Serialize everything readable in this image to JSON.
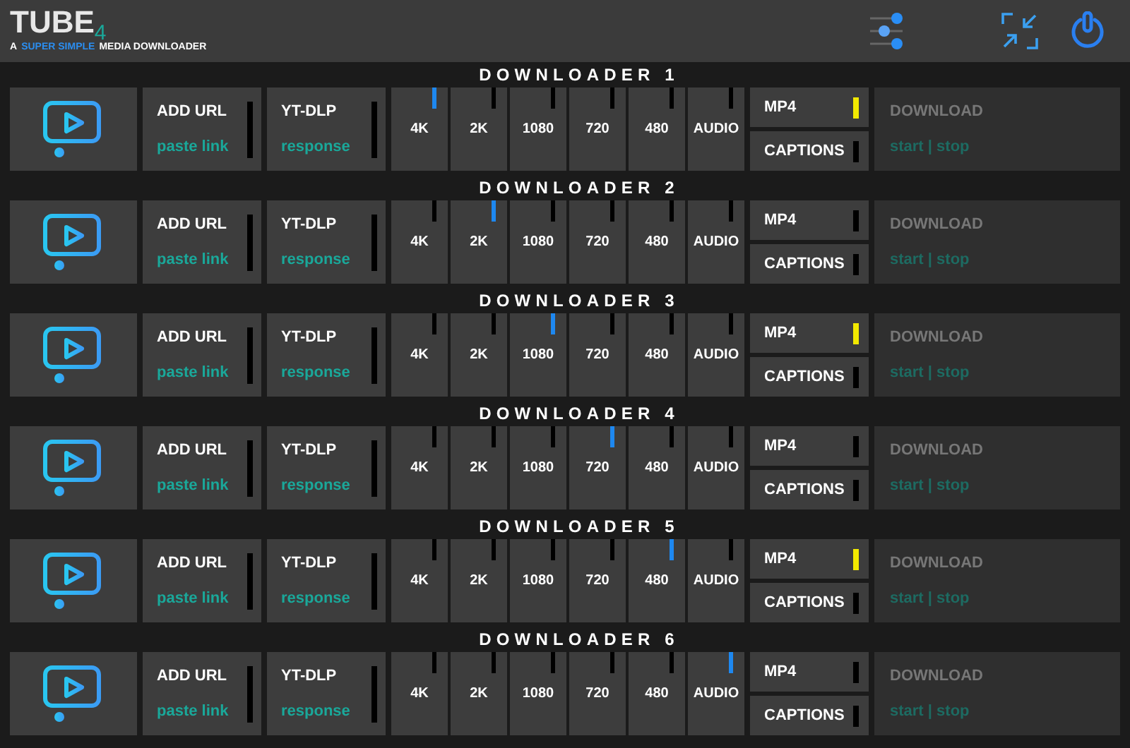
{
  "header": {
    "logo": "TUBE",
    "logo_mark": "4",
    "tagline_start": "A",
    "tagline_highlight": "SUPER SIMPLE",
    "tagline_end": "MEDIA DOWNLOADER"
  },
  "downloaders": [
    {
      "title": "DOWNLOADER 1",
      "add_url": "ADD URL",
      "paste": "paste link",
      "engine": "YT-DLP",
      "response": "response",
      "qualities": [
        {
          "label": "4K",
          "selected": true
        },
        {
          "label": "2K",
          "selected": false
        },
        {
          "label": "1080",
          "selected": false
        },
        {
          "label": "720",
          "selected": false
        },
        {
          "label": "480",
          "selected": false
        },
        {
          "label": "AUDIO",
          "selected": false
        }
      ],
      "mp4": {
        "label": "MP4",
        "on": true
      },
      "captions": {
        "label": "CAPTIONS",
        "on": false
      },
      "download": "DOWNLOAD",
      "controls": "start | stop"
    },
    {
      "title": "DOWNLOADER 2",
      "add_url": "ADD URL",
      "paste": "paste link",
      "engine": "YT-DLP",
      "response": "response",
      "qualities": [
        {
          "label": "4K",
          "selected": false
        },
        {
          "label": "2K",
          "selected": true
        },
        {
          "label": "1080",
          "selected": false
        },
        {
          "label": "720",
          "selected": false
        },
        {
          "label": "480",
          "selected": false
        },
        {
          "label": "AUDIO",
          "selected": false
        }
      ],
      "mp4": {
        "label": "MP4",
        "on": false
      },
      "captions": {
        "label": "CAPTIONS",
        "on": false
      },
      "download": "DOWNLOAD",
      "controls": "start | stop"
    },
    {
      "title": "DOWNLOADER 3",
      "add_url": "ADD URL",
      "paste": "paste link",
      "engine": "YT-DLP",
      "response": "response",
      "qualities": [
        {
          "label": "4K",
          "selected": false
        },
        {
          "label": "2K",
          "selected": false
        },
        {
          "label": "1080",
          "selected": true
        },
        {
          "label": "720",
          "selected": false
        },
        {
          "label": "480",
          "selected": false
        },
        {
          "label": "AUDIO",
          "selected": false
        }
      ],
      "mp4": {
        "label": "MP4",
        "on": true
      },
      "captions": {
        "label": "CAPTIONS",
        "on": false
      },
      "download": "DOWNLOAD",
      "controls": "start | stop"
    },
    {
      "title": "DOWNLOADER 4",
      "add_url": "ADD URL",
      "paste": "paste link",
      "engine": "YT-DLP",
      "response": "response",
      "qualities": [
        {
          "label": "4K",
          "selected": false
        },
        {
          "label": "2K",
          "selected": false
        },
        {
          "label": "1080",
          "selected": false
        },
        {
          "label": "720",
          "selected": true
        },
        {
          "label": "480",
          "selected": false
        },
        {
          "label": "AUDIO",
          "selected": false
        }
      ],
      "mp4": {
        "label": "MP4",
        "on": false
      },
      "captions": {
        "label": "CAPTIONS",
        "on": false
      },
      "download": "DOWNLOAD",
      "controls": "start | stop"
    },
    {
      "title": "DOWNLOADER 5",
      "add_url": "ADD URL",
      "paste": "paste link",
      "engine": "YT-DLP",
      "response": "response",
      "qualities": [
        {
          "label": "4K",
          "selected": false
        },
        {
          "label": "2K",
          "selected": false
        },
        {
          "label": "1080",
          "selected": false
        },
        {
          "label": "720",
          "selected": false
        },
        {
          "label": "480",
          "selected": true
        },
        {
          "label": "AUDIO",
          "selected": false
        }
      ],
      "mp4": {
        "label": "MP4",
        "on": true
      },
      "captions": {
        "label": "CAPTIONS",
        "on": false
      },
      "download": "DOWNLOAD",
      "controls": "start | stop"
    },
    {
      "title": "DOWNLOADER 6",
      "add_url": "ADD URL",
      "paste": "paste link",
      "engine": "YT-DLP",
      "response": "response",
      "qualities": [
        {
          "label": "4K",
          "selected": false
        },
        {
          "label": "2K",
          "selected": false
        },
        {
          "label": "1080",
          "selected": false
        },
        {
          "label": "720",
          "selected": false
        },
        {
          "label": "480",
          "selected": false
        },
        {
          "label": "AUDIO",
          "selected": true
        }
      ],
      "mp4": {
        "label": "MP4",
        "on": false
      },
      "captions": {
        "label": "CAPTIONS",
        "on": false
      },
      "download": "DOWNLOAD",
      "controls": "start | stop"
    }
  ]
}
